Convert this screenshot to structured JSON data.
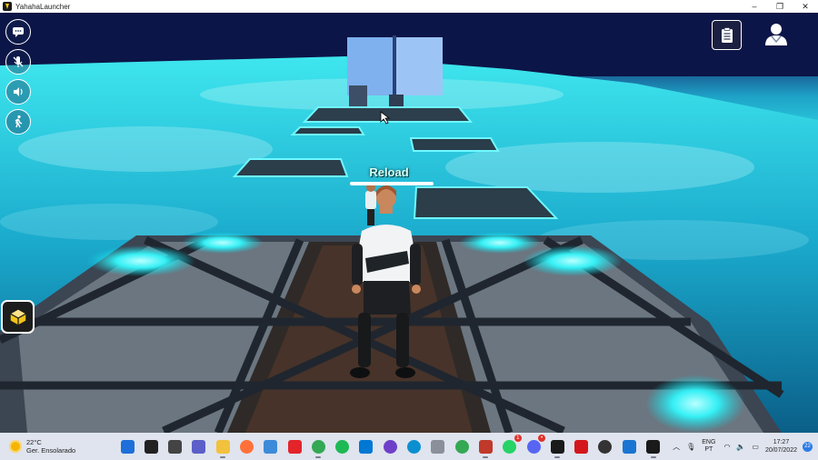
{
  "window": {
    "title": "YahahaLauncher",
    "minimize": "–",
    "maximize": "❐",
    "close": "✕"
  },
  "hud": {
    "left_buttons": [
      "chat-icon",
      "mic-muted-icon",
      "speaker-icon",
      "walk-icon"
    ],
    "side_app": "yahaha-app-icon",
    "top_right": [
      "clipboard-icon",
      "avatar-profile-icon"
    ]
  },
  "game": {
    "reload_label": "Reload",
    "reload_progress": 1.0
  },
  "taskbar": {
    "weather_temp": "22°C",
    "weather_desc": "Ger. Ensolarado",
    "apps": [
      {
        "name": "start-button",
        "color": "#1e6fd9"
      },
      {
        "name": "search-icon",
        "color": "#222222"
      },
      {
        "name": "task-view-icon",
        "color": "#444444"
      },
      {
        "name": "teams-icon",
        "color": "#5b5fc7"
      },
      {
        "name": "file-explorer-icon",
        "color": "#f2c13d"
      },
      {
        "name": "firefox-icon",
        "color": "#ff7139"
      },
      {
        "name": "store-icon",
        "color": "#3c8bd9"
      },
      {
        "name": "red-app-icon",
        "color": "#e3242b"
      },
      {
        "name": "chrome-icon",
        "color": "#34a853"
      },
      {
        "name": "spotify-icon",
        "color": "#1db954"
      },
      {
        "name": "vscode-icon",
        "color": "#0078d4"
      },
      {
        "name": "github-icon",
        "color": "#6e40c9"
      },
      {
        "name": "edge-icon",
        "color": "#0c8fd0"
      },
      {
        "name": "database-icon",
        "color": "#8a8f99"
      },
      {
        "name": "chrome-profile-icon",
        "color": "#34a853"
      },
      {
        "name": "notepad-icon",
        "color": "#c0392b"
      },
      {
        "name": "whatsapp-icon",
        "color": "#25d366",
        "badge": "1"
      },
      {
        "name": "discord-icon",
        "color": "#5865f2",
        "badge": "•"
      },
      {
        "name": "launcher-icon",
        "color": "#1a1a1a"
      },
      {
        "name": "acrobat-icon",
        "color": "#d4161c"
      },
      {
        "name": "clock-app-icon",
        "color": "#333333"
      },
      {
        "name": "blue-app-icon",
        "color": "#1a75d2"
      },
      {
        "name": "yahaha-taskbar-icon",
        "color": "#1a1a1a"
      }
    ],
    "lang_top": "ENG",
    "lang_bottom": "PT",
    "time": "17:27",
    "date": "20/07/2022",
    "notification_count": "22"
  }
}
